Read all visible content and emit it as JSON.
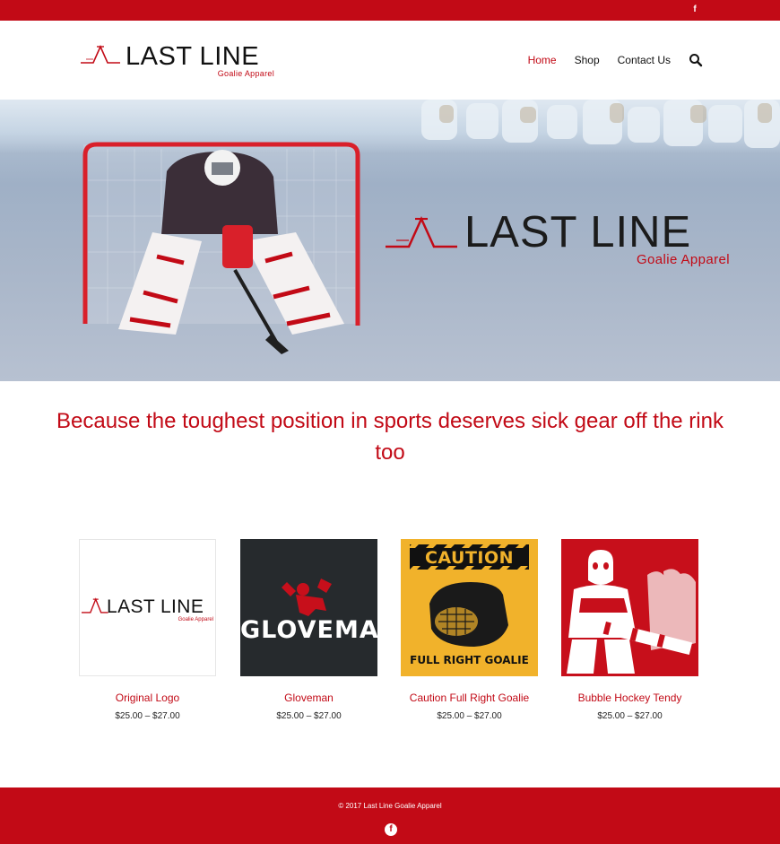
{
  "topbar": {
    "social_icon": "f"
  },
  "header": {
    "logo_word": "LAST LINE",
    "logo_sub": "Goalie Apparel",
    "nav": [
      {
        "label": "Home"
      },
      {
        "label": "Shop"
      },
      {
        "label": "Contact Us"
      }
    ]
  },
  "hero": {
    "logo_word": "LAST LINE",
    "logo_sub": "Goalie Apparel"
  },
  "tagline": "Because the toughest position in sports deserves sick gear off the rink too",
  "products": [
    {
      "name": "Original Logo",
      "price": "$25.00 – $27.00",
      "thumb_word": "LAST LINE",
      "thumb_sub": "Goalie Apparel"
    },
    {
      "name": "Gloveman",
      "price": "$25.00 – $27.00",
      "thumb_word": "GLOVEMAN"
    },
    {
      "name": "Caution Full Right Goalie",
      "price": "$25.00 – $27.00",
      "thumb_top": "CAUTION",
      "thumb_bottom": "FULL RIGHT GOALIE"
    },
    {
      "name": "Bubble Hockey Tendy",
      "price": "$25.00 – $27.00"
    }
  ],
  "footer": {
    "copyright": "© 2017 Last Line Goalie Apparel",
    "social_icon": "f"
  },
  "colors": {
    "brand_red": "#c20a16",
    "dark": "#262a2d",
    "caution_yellow": "#f1b22b"
  }
}
